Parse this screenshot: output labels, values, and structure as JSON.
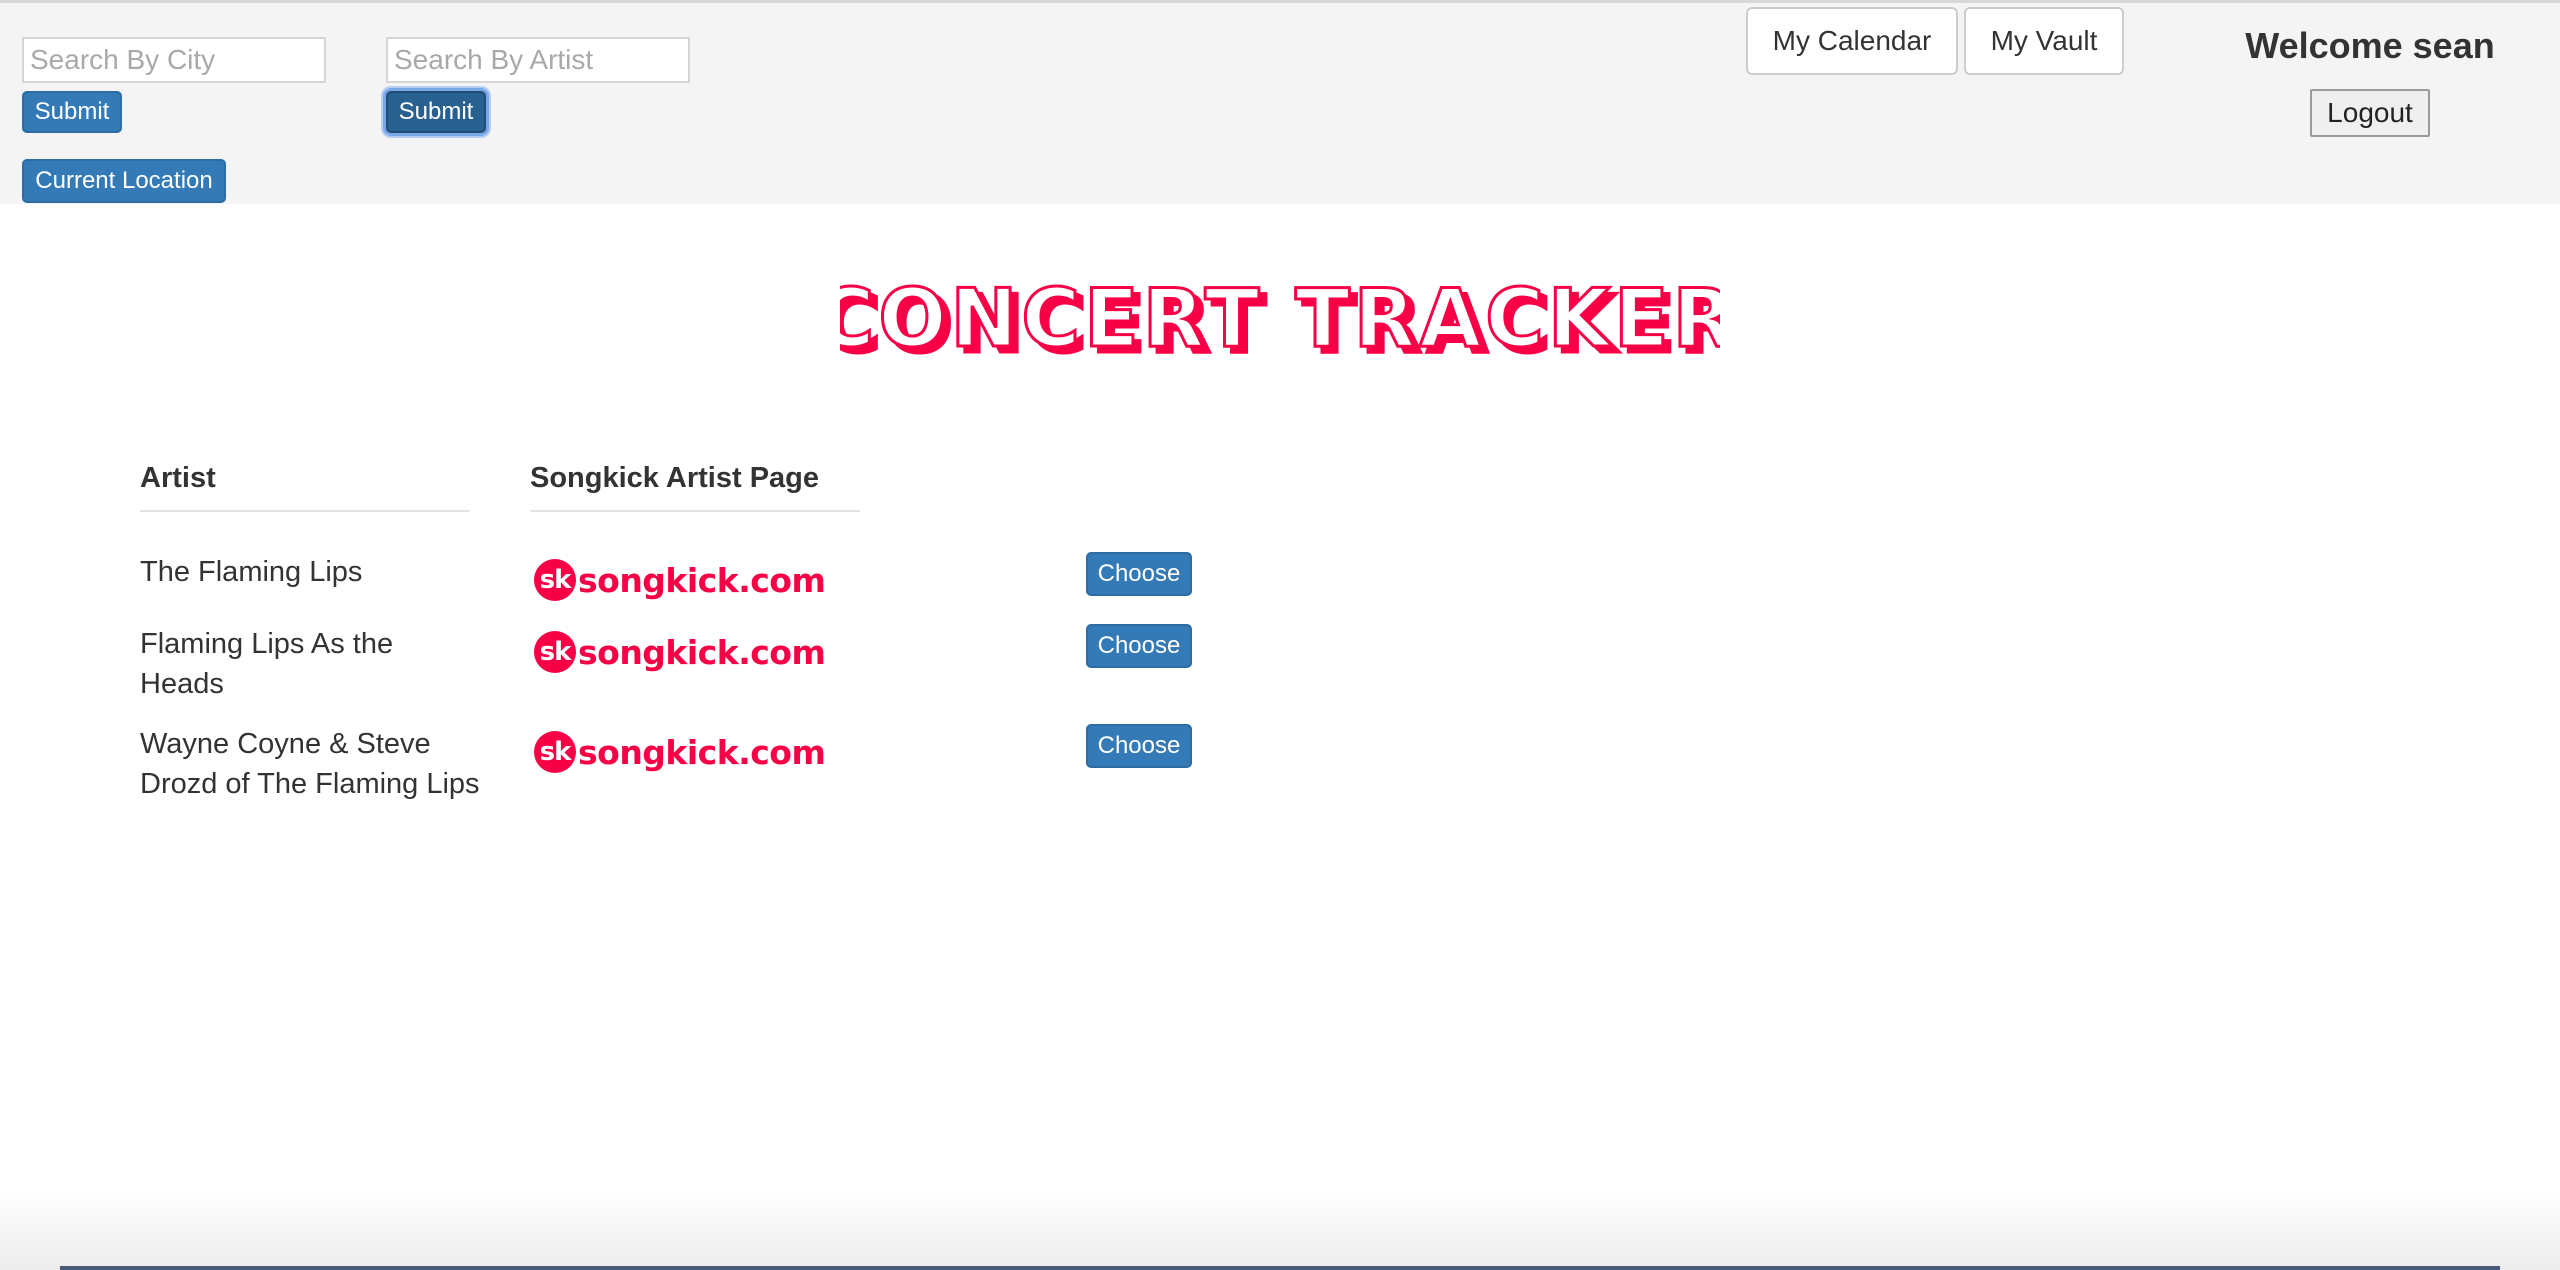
{
  "header": {
    "city_search": {
      "placeholder": "Search By City",
      "value": "",
      "submit_label": "Submit"
    },
    "artist_search": {
      "placeholder": "Search By Artist",
      "value": "",
      "submit_label": "Submit"
    },
    "current_location_label": "Current Location",
    "nav": {
      "calendar_label": "My Calendar",
      "vault_label": "My Vault"
    },
    "welcome_text": "Welcome sean",
    "logout_label": "Logout"
  },
  "logo": {
    "text": "CONCERT TRACKER",
    "color": "#f80046"
  },
  "table": {
    "columns": {
      "artist": "Artist",
      "songkick": "Songkick Artist Page"
    },
    "rows": [
      {
        "artist": "The Flaming Lips",
        "link_badge": "sk",
        "link_text": "songkick.com",
        "action_label": "Choose"
      },
      {
        "artist": "Flaming Lips As the Heads",
        "link_badge": "sk",
        "link_text": "songkick.com",
        "action_label": "Choose"
      },
      {
        "artist": "Wayne Coyne & Steve Drozd of The Flaming Lips",
        "link_badge": "sk",
        "link_text": "songkick.com",
        "action_label": "Choose"
      }
    ]
  },
  "colors": {
    "primary": "#337ab7",
    "brand_pink": "#f80046",
    "header_bg": "#f4f4f4"
  }
}
